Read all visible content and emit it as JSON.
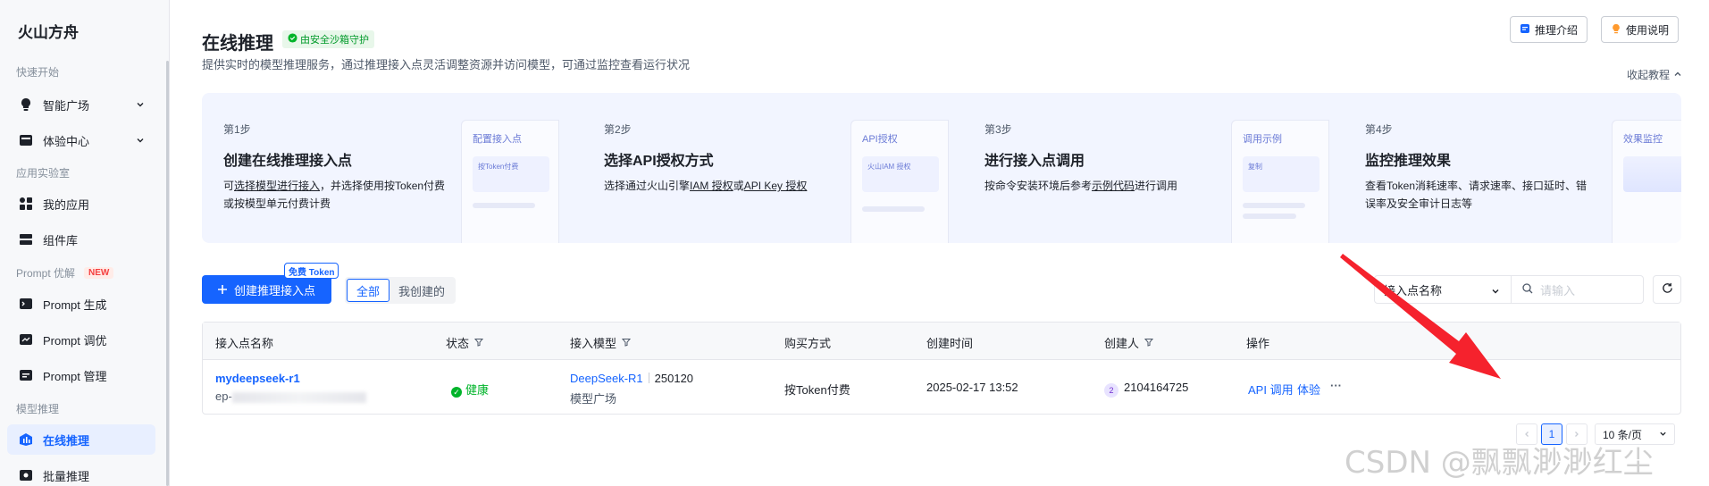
{
  "sidebar": {
    "brand": "火山方舟",
    "sections": {
      "quickstart": "快速开始",
      "lab": "应用实验室",
      "prompt": "Prompt 优解",
      "inference": "模型推理"
    },
    "new_badge": "NEW",
    "items": {
      "square": "智能广场",
      "experience": "体验中心",
      "my_apps": "我的应用",
      "components": "组件库",
      "prompt_gen": "Prompt 生成",
      "prompt_tune": "Prompt 调优",
      "prompt_manage": "Prompt 管理",
      "online_infer": "在线推理",
      "batch_infer": "批量推理"
    }
  },
  "header": {
    "title": "在线推理",
    "sandbox_badge": "由安全沙箱守护",
    "subtitle": "提供实时的模型推理服务，通过推理接入点灵活调整资源并访问模型，可通过监控查看运行状况",
    "intro_button": "推理介绍",
    "guide_button": "使用说明",
    "collapse": "收起教程"
  },
  "steps": [
    {
      "num": "第1步",
      "title": "创建在线推理入点",
      "preview_title": "配置接入点",
      "preview_box": "按Token付费"
    },
    {
      "num": "第2步",
      "title": "选择API授权方式",
      "preview_title": "API授权",
      "preview_box": "火山IAM 授权"
    },
    {
      "num": "第3步",
      "title": "进行接入点调用",
      "preview_title": "调用示例",
      "preview_box": "复制"
    },
    {
      "num": "第4步",
      "title": "监控推理效果",
      "preview_title": "效果监控",
      "preview_box": ""
    }
  ],
  "step_desc": {
    "s1_a": "可",
    "s1_link": "选择模型进行接入",
    "s1_b": "，并选择使用按Token付费或按模型单元付费计费",
    "s2_a": "选择通过火山引擎",
    "s2_link1": "IAM 授权",
    "s2_mid": "或",
    "s2_link2": "API Key 授权",
    "s3_a": "按命令安装环境后参考",
    "s3_link": "示例代码",
    "s3_b": "进行调用",
    "s4": "查看Token消耗速率、请求速率、接口延时、错误率及安全审计日志等"
  },
  "step1_title_full": "创建在线推理接入点",
  "toolbar": {
    "create": "创建推理接入点",
    "free_tag": "免费 Token",
    "tab_all": "全部",
    "tab_mine": "我创建的",
    "filter": "接入点名称",
    "search_placeholder": "请输入"
  },
  "table": {
    "headers": [
      "接入点名称",
      "状态",
      "接入模型",
      "购买方式",
      "创建时间",
      "创建人",
      "操作"
    ],
    "row": {
      "name": "mydeepseek-r1",
      "ep_prefix": "ep-",
      "status": "健康",
      "model": "DeepSeek-R1",
      "version": "250120",
      "source": "模型广场",
      "purchase": "按Token付费",
      "created": "2025-02-17 13:52",
      "creator_badge": "2",
      "creator": "2104164725",
      "action_api": "API 调用",
      "action_try": "体验",
      "action_more": "···"
    }
  },
  "pagination": {
    "current": "1",
    "size": "10 条/页"
  },
  "watermark": "CSDN @飘飘渺渺红尘",
  "colors": {
    "accent": "#1664ff",
    "arrow": "#f5222d",
    "success": "#00b42a"
  }
}
